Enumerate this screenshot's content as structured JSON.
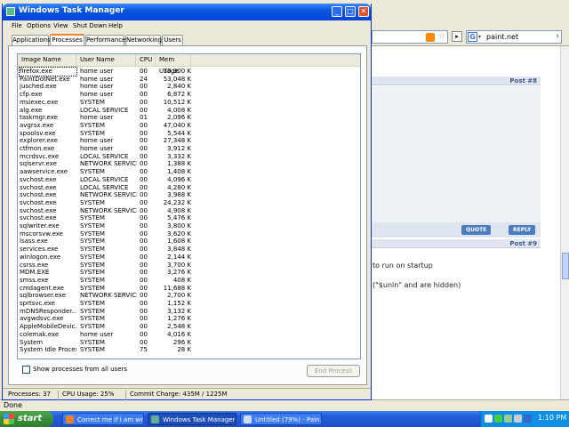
{
  "browser": {
    "search_text": "paint.net",
    "status_text": "Done",
    "post8_label": "Post #8",
    "post9_label": "Post #9",
    "quote_label": "QUOTE",
    "reply_label": "REPLY",
    "post_text_1": "to run on startup",
    "post_text_2": "(\"$unin\" and are hidden)"
  },
  "taskmgr": {
    "title": "Windows Task Manager",
    "menu": [
      "File",
      "Options",
      "View",
      "Shut Down",
      "Help"
    ],
    "tabs": [
      "Applications",
      "Processes",
      "Performance",
      "Networking",
      "Users"
    ],
    "active_tab": "Processes",
    "columns": [
      "Image Name",
      "User Name",
      "CPU",
      "Mem Usage"
    ],
    "processes": [
      [
        "firefox.exe",
        "home user",
        "00",
        "70,900 K"
      ],
      [
        "PaintDotNet.exe",
        "home user",
        "24",
        "53,048 K"
      ],
      [
        "jusched.exe",
        "home user",
        "00",
        "2,840 K"
      ],
      [
        "cfp.exe",
        "home user",
        "00",
        "6,872 K"
      ],
      [
        "msiexec.exe",
        "SYSTEM",
        "00",
        "10,512 K"
      ],
      [
        "alg.exe",
        "LOCAL SERVICE",
        "00",
        "4,008 K"
      ],
      [
        "taskmgr.exe",
        "home user",
        "01",
        "2,096 K"
      ],
      [
        "avgrsx.exe",
        "SYSTEM",
        "00",
        "47,040 K"
      ],
      [
        "spoolsv.exe",
        "SYSTEM",
        "00",
        "5,544 K"
      ],
      [
        "explorer.exe",
        "home user",
        "00",
        "27,348 K"
      ],
      [
        "ctfmon.exe",
        "home user",
        "00",
        "3,912 K"
      ],
      [
        "mcrdsvc.exe",
        "LOCAL SERVICE",
        "00",
        "3,332 K"
      ],
      [
        "sqlservr.exe",
        "NETWORK SERVICE",
        "00",
        "1,388 K"
      ],
      [
        "aawservice.exe",
        "SYSTEM",
        "00",
        "1,408 K"
      ],
      [
        "svchost.exe",
        "LOCAL SERVICE",
        "00",
        "4,096 K"
      ],
      [
        "svchost.exe",
        "LOCAL SERVICE",
        "00",
        "4,280 K"
      ],
      [
        "svchost.exe",
        "NETWORK SERVICE",
        "00",
        "3,988 K"
      ],
      [
        "svchost.exe",
        "SYSTEM",
        "00",
        "24,232 K"
      ],
      [
        "svchost.exe",
        "NETWORK SERVICE",
        "00",
        "4,908 K"
      ],
      [
        "svchost.exe",
        "SYSTEM",
        "00",
        "5,476 K"
      ],
      [
        "sqlwriter.exe",
        "SYSTEM",
        "00",
        "3,800 K"
      ],
      [
        "mscorsvw.exe",
        "SYSTEM",
        "00",
        "3,620 K"
      ],
      [
        "lsass.exe",
        "SYSTEM",
        "00",
        "1,608 K"
      ],
      [
        "services.exe",
        "SYSTEM",
        "00",
        "3,848 K"
      ],
      [
        "winlogon.exe",
        "SYSTEM",
        "00",
        "2,144 K"
      ],
      [
        "csrss.exe",
        "SYSTEM",
        "00",
        "3,700 K"
      ],
      [
        "MDM.EXE",
        "SYSTEM",
        "00",
        "3,276 K"
      ],
      [
        "smss.exe",
        "SYSTEM",
        "00",
        "408 K"
      ],
      [
        "cmdagent.exe",
        "SYSTEM",
        "00",
        "11,688 K"
      ],
      [
        "sqlbrowser.exe",
        "NETWORK SERVICE",
        "00",
        "2,700 K"
      ],
      [
        "sprtsvc.exe",
        "SYSTEM",
        "00",
        "1,152 K"
      ],
      [
        "mDNSResponder....",
        "SYSTEM",
        "00",
        "3,132 K"
      ],
      [
        "avgwdsvc.exe",
        "SYSTEM",
        "00",
        "1,276 K"
      ],
      [
        "AppleMobileDevic...",
        "SYSTEM",
        "00",
        "2,548 K"
      ],
      [
        "colemak.exe",
        "home user",
        "00",
        "4,016 K"
      ],
      [
        "System",
        "SYSTEM",
        "00",
        "296 K"
      ],
      [
        "System Idle Process",
        "SYSTEM",
        "75",
        "28 K"
      ]
    ],
    "show_all_label": "Show processes from all users",
    "end_process_label": "End Process",
    "status_processes": "Processes: 37",
    "status_cpu": "CPU Usage: 25%",
    "status_commit": "Commit Charge: 435M / 1225M"
  },
  "taskbar": {
    "start_label": "start",
    "tasks": [
      "Correct me if I am wr...",
      "Windows Task Manager",
      "Untitled (79%) - Pain..."
    ],
    "clock": "1:10 PM"
  },
  "colors": {
    "titlebar": "#0a55e0",
    "taskbar": "#245edb",
    "start": "#3a8e3a",
    "active_tab_accent": "#e68b2c"
  }
}
